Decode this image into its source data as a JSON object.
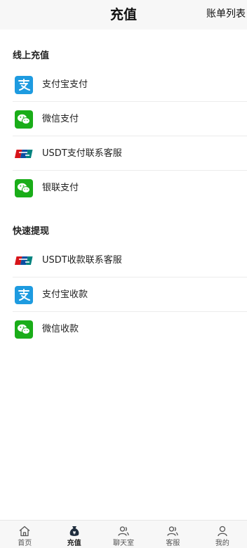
{
  "header": {
    "title": "充值",
    "bill_link": "账单列表"
  },
  "online_recharge": {
    "title": "线上充值",
    "items": [
      {
        "label": "支付宝支付",
        "icon": "alipay-icon"
      },
      {
        "label": "微信支付",
        "icon": "wechat-icon"
      },
      {
        "label": "USDT支付联系客服",
        "icon": "unionpay-card-icon"
      },
      {
        "label": "银联支付",
        "icon": "wechat-icon"
      }
    ]
  },
  "quick_withdraw": {
    "title": "快速提现",
    "items": [
      {
        "label": "USDT收款联系客服",
        "icon": "unionpay-card-icon"
      },
      {
        "label": "支付宝收款",
        "icon": "alipay-icon"
      },
      {
        "label": "微信收款",
        "icon": "wechat-icon"
      }
    ]
  },
  "tabbar": {
    "active_index": 1,
    "items": [
      {
        "label": "首页",
        "icon": "home-icon"
      },
      {
        "label": "充值",
        "icon": "money-bag-icon"
      },
      {
        "label": "聊天室",
        "icon": "chat-users-icon"
      },
      {
        "label": "客服",
        "icon": "customer-service-icon"
      },
      {
        "label": "我的",
        "icon": "user-icon"
      }
    ]
  },
  "colors": {
    "alipay": "#1e9be0",
    "wechat": "#1aad19",
    "header_bg": "#f7f7f7"
  }
}
